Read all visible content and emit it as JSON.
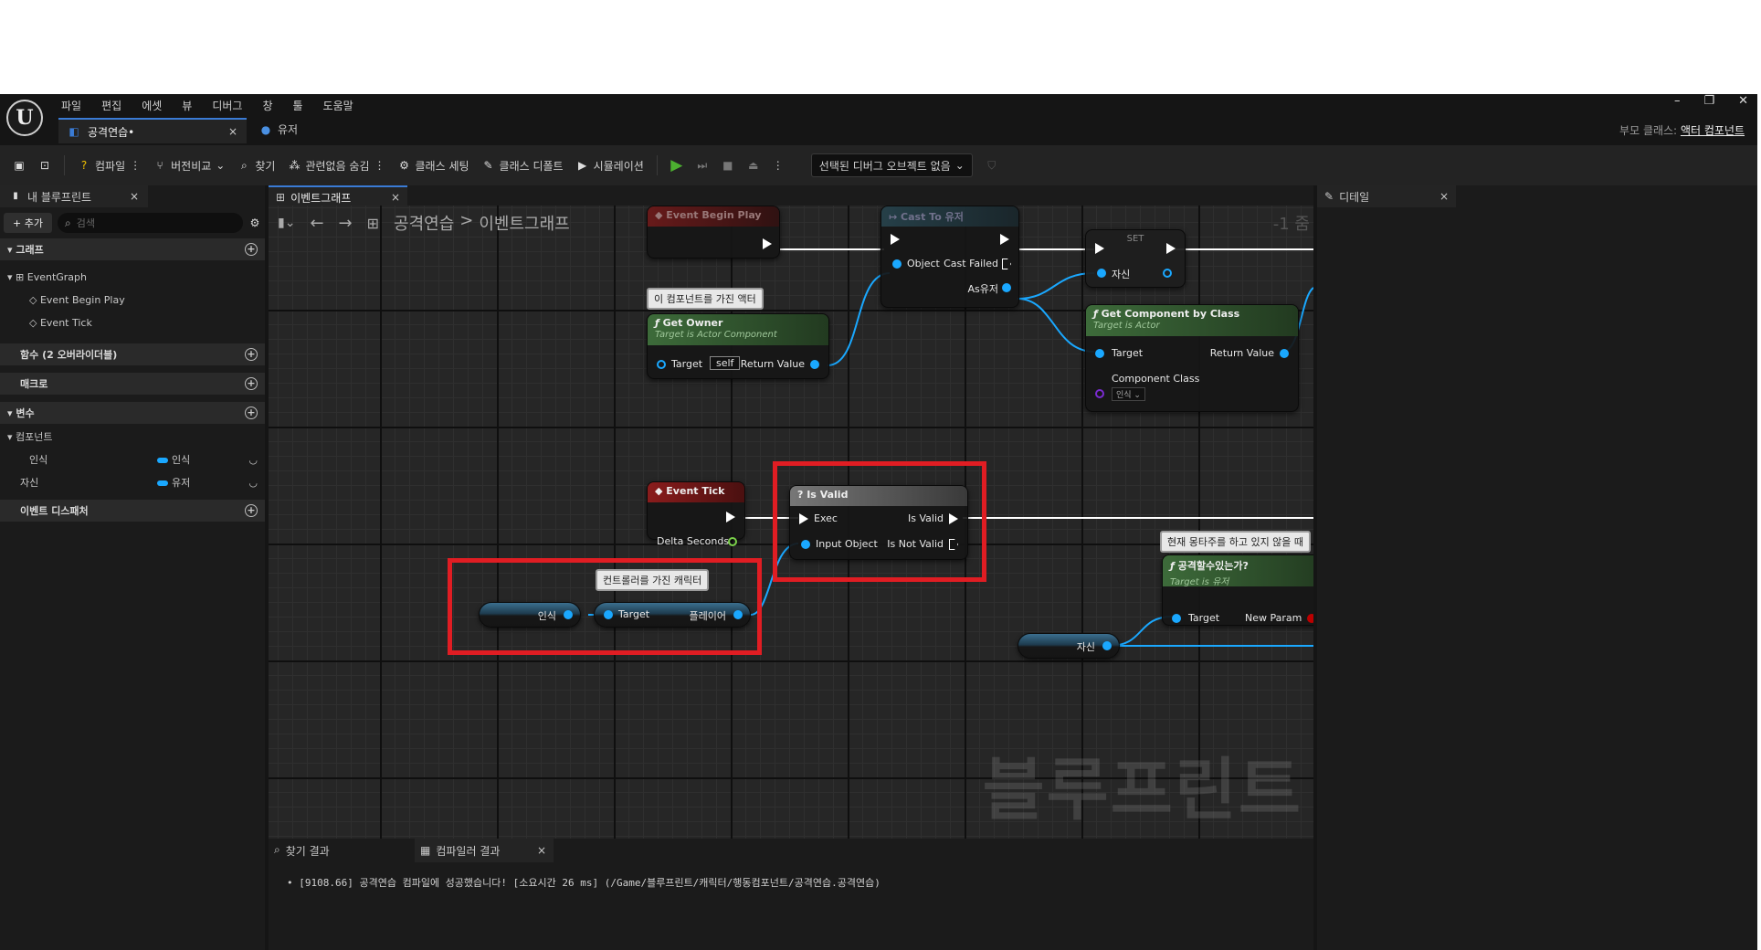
{
  "app": {
    "menu": [
      "파일",
      "편집",
      "에셋",
      "뷰",
      "디버그",
      "창",
      "툴",
      "도움말"
    ],
    "tabs": [
      {
        "label": "공격연습•",
        "active": true,
        "close": "×"
      },
      {
        "label": "유저",
        "active": false
      }
    ],
    "parent_class_label": "부모 클래스:",
    "parent_class_value": "액터 컴포넌트"
  },
  "toolbar": {
    "compile": "컴파일",
    "diff": "버전비교",
    "find": "찾기",
    "hide_unrelated": "관련없음 숨김",
    "class_settings": "클래스 세팅",
    "class_defaults": "클래스 디폴트",
    "simulation": "시뮬레이션",
    "debug_object": "선택된 디버그 오브젝트 없음"
  },
  "left_panel": {
    "tab_title": "내 블루프린트",
    "add_button": "+ 추가",
    "search_placeholder": "검색",
    "sections": {
      "graphs": "그래프",
      "functions": "함수 (2 오버라이더블)",
      "macros": "매크로",
      "variables": "변수",
      "components": "컴포넌트",
      "dispatchers": "이벤트 디스패처"
    },
    "event_graph": "EventGraph",
    "events": [
      "Event Begin Play",
      "Event Tick"
    ],
    "vars": [
      {
        "name": "인식",
        "type": "인식"
      },
      {
        "name": "자신",
        "type": "유저"
      }
    ]
  },
  "graph_tab": {
    "label": "이벤트그래프",
    "breadcrumb_root": "공격연습",
    "breadcrumb_sep": ">",
    "breadcrumb_leaf": "이벤트그래프",
    "zoom": "-1 줌",
    "watermark": "블루프린트"
  },
  "nodes": {
    "begin_play": "Event Begin Play",
    "cast": {
      "title": "Cast To 유저",
      "object": "Object",
      "failed": "Cast Failed",
      "as": "As유저"
    },
    "set": {
      "title": "SET",
      "pin": "자신"
    },
    "comment_owner": "이 컴포넌트를 가진 액터",
    "get_owner": {
      "title": "Get Owner",
      "sub": "Target is Actor Component",
      "target": "Target",
      "self": "self",
      "ret": "Return Value"
    },
    "get_comp": {
      "title": "Get Component by Class",
      "sub": "Target is Actor",
      "target": "Target",
      "ret": "Return Value",
      "class": "Component Class",
      "class_val": "인식"
    },
    "tick": {
      "title": "Event Tick",
      "delta": "Delta Seconds"
    },
    "is_valid": {
      "title": "Is Valid",
      "exec": "Exec",
      "valid": "Is Valid",
      "input": "Input Object",
      "not_valid": "Is Not Valid"
    },
    "comment_ctrl": "컨트롤러를 가진 캐릭터",
    "var_get_1": "인식",
    "player_node": {
      "target": "Target",
      "out": "플레이어"
    },
    "comment_anim": "현재 몽타주를 하고 있지 않을 때",
    "can_attack": {
      "title": "공격할수있는가?",
      "sub": "Target is 유저",
      "target": "Target",
      "param": "New Param"
    },
    "var_get_2": "자신"
  },
  "right_panel": {
    "tab_title": "디테일"
  },
  "bottom": {
    "find_tab": "찾기 결과",
    "compiler_tab": "컴파일러 결과",
    "log": "[9108.66] 공격연습 컴파일에 성공했습니다! [소요시간 26 ms] (/Game/블루프린트/캐릭터/행동컴포넌트/공격연습.공격연습)"
  },
  "colors": {
    "accent": "#3a7bd5",
    "object_pin": "#1aa8ff",
    "highlight": "#e01d23",
    "event_header": "#8a1c1c",
    "func_header": "#3d6b3a",
    "cast_header": "#2a4a55"
  }
}
